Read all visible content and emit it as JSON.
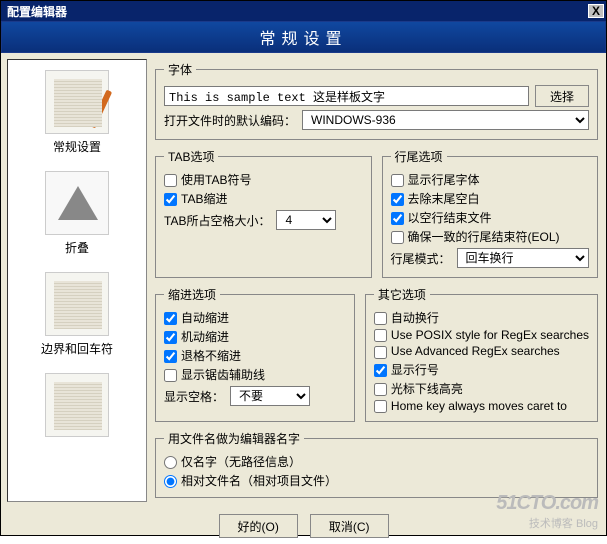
{
  "titlebar": {
    "title": "配置编辑器",
    "close": "X"
  },
  "header": "常规设置",
  "sidebar": {
    "items": [
      {
        "label": "常规设置"
      },
      {
        "label": "折叠"
      },
      {
        "label": "边界和回车符"
      }
    ]
  },
  "font_group": {
    "legend": "字体",
    "sample": "This is sample text 这是样板文字",
    "choose": "选择",
    "encoding_label": "打开文件时的默认编码：",
    "encoding": "WINDOWS-936"
  },
  "tab_group": {
    "legend": "TAB选项",
    "use_tab": "使用TAB符号",
    "tab_indent": "TAB缩进",
    "tab_size_label": "TAB所占空格大小：",
    "tab_size": "4"
  },
  "eol_group": {
    "legend": "行尾选项",
    "show_eol_font": "显示行尾字体",
    "strip_trailing": "去除末尾空白",
    "end_blank_line": "以空行结束文件",
    "ensure_consistent": "确保一致的行尾结束符(EOL)",
    "mode_label": "行尾模式：",
    "mode": "回车换行"
  },
  "indent_group": {
    "legend": "缩进选项",
    "auto_indent": "自动缩进",
    "smart_indent": "机动缩进",
    "backspace_unindent": "退格不缩进",
    "show_guides": "显示锯齿辅助线",
    "show_space_label": "显示空格：",
    "show_space": "不要"
  },
  "other_group": {
    "legend": "其它选项",
    "auto_wrap": "自动换行",
    "posix": "Use POSIX style for RegEx searches",
    "advanced": "Use Advanced RegEx searches",
    "show_lineno": "显示行号",
    "cursor_hl": "光标下线高亮",
    "home_key": "Home key always moves caret to"
  },
  "filename_group": {
    "legend": "用文件名做为编辑器名字",
    "name_only": "仅名字（无路径信息）",
    "relative": "相对文件名（相对项目文件）"
  },
  "footer": {
    "ok": "好的(O)",
    "cancel": "取消(C)"
  },
  "watermark": {
    "big": "51CTO.com",
    "sm": "技术博客   Blog"
  }
}
